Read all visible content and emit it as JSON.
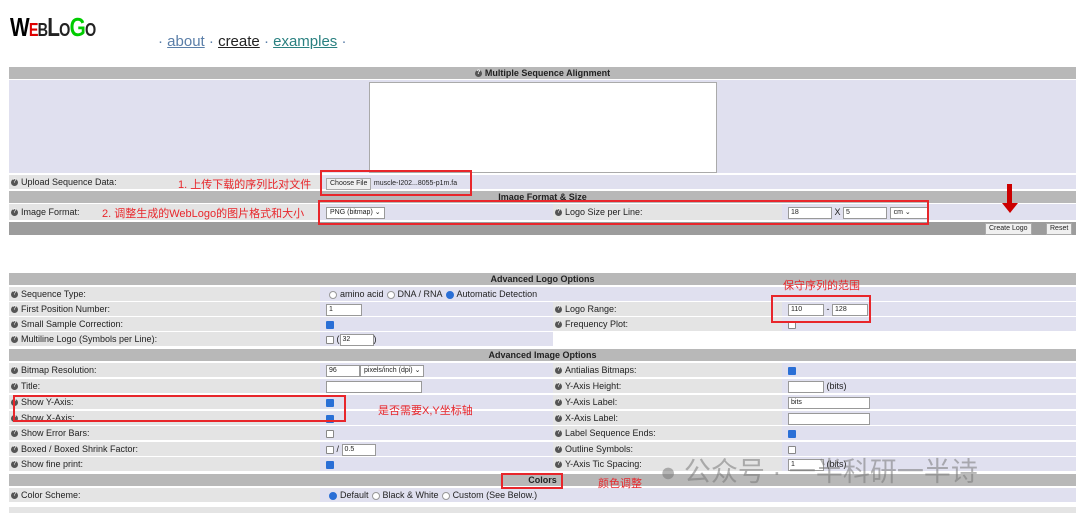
{
  "logo": "WEBLOGO",
  "nav": {
    "about": "about",
    "create": "create",
    "examples": "examples",
    "sep": "·"
  },
  "msa": {
    "header": "Multiple Sequence Alignment",
    "upload_label": "Upload Sequence Data:",
    "choose_file": "Choose File",
    "file_name": "muscle-I202...8055-p1m.fa"
  },
  "img": {
    "header": "Image Format & Size",
    "format_label": "Image Format:",
    "format_value": "PNG (bitmap)",
    "size_label": "Logo Size per Line:",
    "width": "18",
    "x": "X",
    "height": "5",
    "unit": "cm",
    "create": "Create Logo",
    "reset": "Reset"
  },
  "adv_logo": {
    "header": "Advanced Logo Options",
    "seq_type_label": "Sequence Type:",
    "seq_opts": [
      "amino acid",
      "DNA / RNA",
      "Automatic Detection"
    ],
    "first_pos_label": "First Position Number:",
    "first_pos": "1",
    "range_label": "Logo Range:",
    "range_from": "110",
    "range_dash": "-",
    "range_to": "128",
    "small_label": "Small Sample Correction:",
    "freq_label": "Frequency Plot:",
    "multi_label": "Multiline Logo (Symbols per Line):",
    "multi_value": "32",
    "paren_open": "(",
    "paren_close": ")"
  },
  "adv_img": {
    "header": "Advanced Image Options",
    "res_label": "Bitmap Resolution:",
    "res_value": "96",
    "res_unit": "pixels/inch (dpi)",
    "anti_label": "Antialias Bitmaps:",
    "title_label": "Title:",
    "yh_label": "Y-Axis Height:",
    "bits": "(bits)",
    "showy_label": "Show Y-Axis:",
    "ylab_label": "Y-Axis Label:",
    "ylab_value": "bits",
    "showx_label": "Show X-Axis:",
    "xlab_label": "X-Axis Label:",
    "err_label": "Show Error Bars:",
    "ends_label": "Label Sequence Ends:",
    "boxed_label": "Boxed / Boxed Shrink Factor:",
    "slash": "/",
    "shrink": "0.5",
    "outline_label": "Outline Symbols:",
    "fine_label": "Show fine print:",
    "tic_label": "Y-Axis Tic Spacing:",
    "tic_value": "1"
  },
  "colors": {
    "header": "Colors",
    "scheme_label": "Color Scheme:",
    "opts": [
      "Default",
      "Black & White",
      "Custom (See Below.)"
    ]
  },
  "annotations": {
    "a1": "1. 上传下载的序列比对文件",
    "a2": "2. 调整生成的WebLogo的图片格式和大小",
    "a3": "保守序列的范围",
    "a4": "是否需要X,Y坐标轴",
    "a5": "颜色调整"
  },
  "watermark": "公众号 · 一半科研一半诗"
}
